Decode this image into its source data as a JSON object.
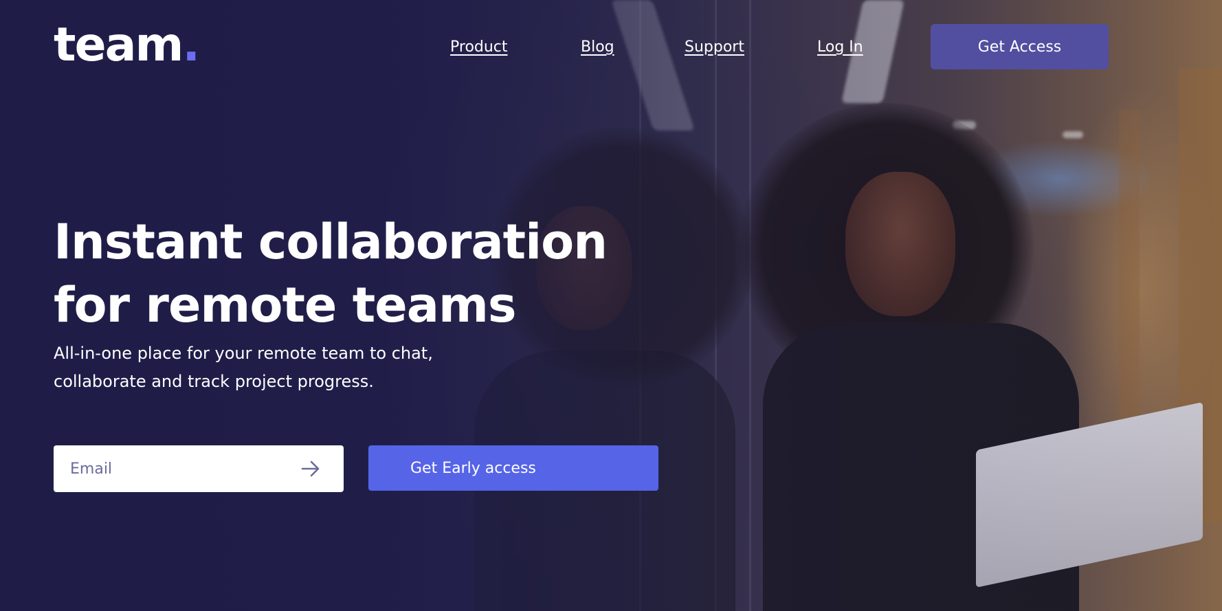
{
  "brand": {
    "name": "team",
    "dot": ".",
    "accent_color": "#6b6ef0"
  },
  "nav": {
    "links": [
      {
        "label": "Product"
      },
      {
        "label": "Blog"
      },
      {
        "label": "Support"
      },
      {
        "label": "Log In"
      }
    ],
    "cta_label": "Get Access",
    "cta_color": "#524fa1"
  },
  "hero": {
    "headline_line1": "Instant collaboration",
    "headline_line2": "for remote teams",
    "subtext_line1": "All-in-one place for your remote team to chat,",
    "subtext_line2": "collaborate and track project progress.",
    "email_placeholder": "Email",
    "email_value": "",
    "submit_icon": "arrow-right-icon",
    "early_access_label": "Get Early access",
    "early_access_color": "#5664e8",
    "background_color": "#1e1c45"
  }
}
